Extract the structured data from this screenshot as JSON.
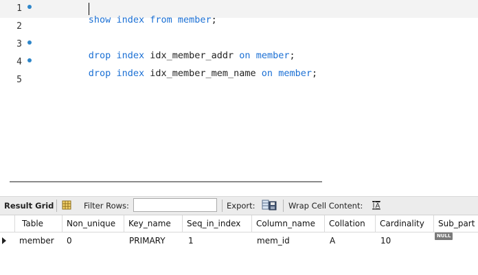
{
  "editor": {
    "lines": [
      {
        "num": "1",
        "dot": true,
        "tokens": [
          [
            "kw",
            "show"
          ],
          [
            "sp",
            " "
          ],
          [
            "kw",
            "index"
          ],
          [
            "sp",
            " "
          ],
          [
            "kw",
            "from"
          ],
          [
            "sp",
            " "
          ],
          [
            "kw",
            "member"
          ],
          [
            "id",
            ";"
          ]
        ]
      },
      {
        "num": "2",
        "dot": false,
        "tokens": []
      },
      {
        "num": "3",
        "dot": true,
        "tokens": [
          [
            "kw",
            "drop"
          ],
          [
            "sp",
            " "
          ],
          [
            "kw",
            "index"
          ],
          [
            "sp",
            " "
          ],
          [
            "id",
            "idx_member_addr"
          ],
          [
            "sp",
            " "
          ],
          [
            "kw",
            "on"
          ],
          [
            "sp",
            " "
          ],
          [
            "kw",
            "member"
          ],
          [
            "id",
            ";"
          ]
        ]
      },
      {
        "num": "4",
        "dot": true,
        "tokens": [
          [
            "kw",
            "drop"
          ],
          [
            "sp",
            " "
          ],
          [
            "kw",
            "index"
          ],
          [
            "sp",
            " "
          ],
          [
            "id",
            "idx_member_mem_name"
          ],
          [
            "sp",
            " "
          ],
          [
            "kw",
            "on"
          ],
          [
            "sp",
            " "
          ],
          [
            "kw",
            "member"
          ],
          [
            "id",
            ";"
          ]
        ]
      },
      {
        "num": "5",
        "dot": false,
        "tokens": []
      }
    ]
  },
  "toolbar": {
    "result_grid": "Result Grid",
    "filter_rows": "Filter Rows:",
    "filter_value": "",
    "export": "Export:",
    "wrap_cell": "Wrap Cell Content:"
  },
  "grid": {
    "columns": [
      "Table",
      "Non_unique",
      "Key_name",
      "Seq_in_index",
      "Column_name",
      "Collation",
      "Cardinality",
      "Sub_part"
    ],
    "rows": [
      [
        "member",
        "0",
        "PRIMARY",
        "1",
        "mem_id",
        "A",
        "10",
        "NULL"
      ]
    ]
  },
  "colors": {
    "keyword": "#1a6fd4",
    "marker_dot": "#2e86c9",
    "toolbar_bg": "#ececec"
  }
}
